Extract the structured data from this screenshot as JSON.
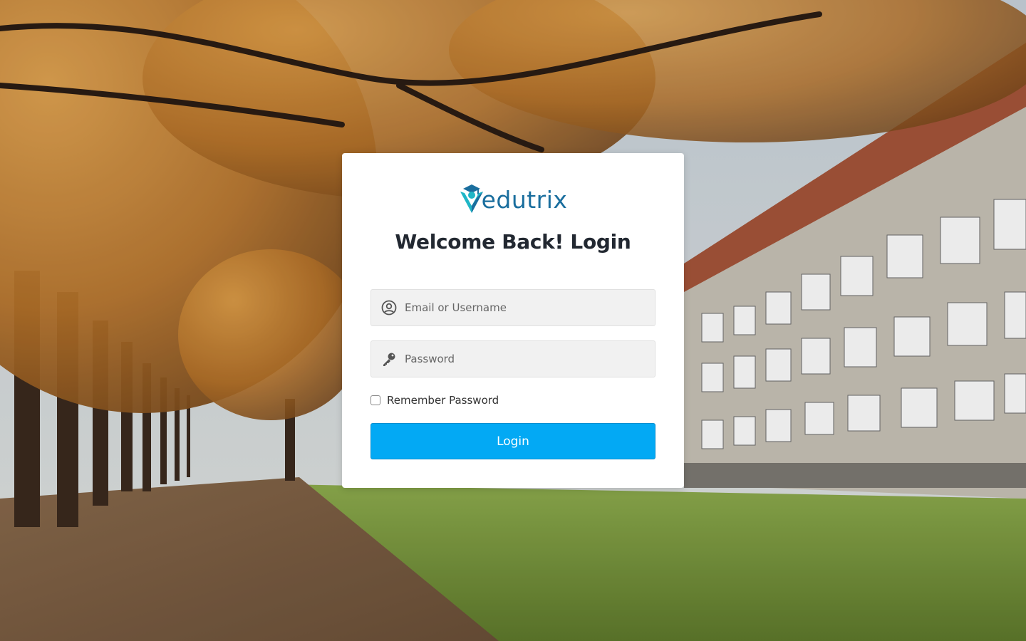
{
  "brand": {
    "name": "edutrix",
    "logo_icon": "graduate-cap-logo-icon",
    "colors": {
      "teal": "#1fb6c6",
      "blue": "#1a6e9e"
    }
  },
  "login": {
    "title": "Welcome Back! Login",
    "email": {
      "placeholder": "Email or Username",
      "value": "",
      "icon": "user-circle-icon"
    },
    "password": {
      "placeholder": "Password",
      "value": "",
      "icon": "key-icon"
    },
    "remember_label": "Remember Password",
    "remember_checked": false,
    "submit_label": "Login"
  },
  "colors": {
    "button": "#03a9f4",
    "card": "#ffffff",
    "title": "#222831"
  }
}
